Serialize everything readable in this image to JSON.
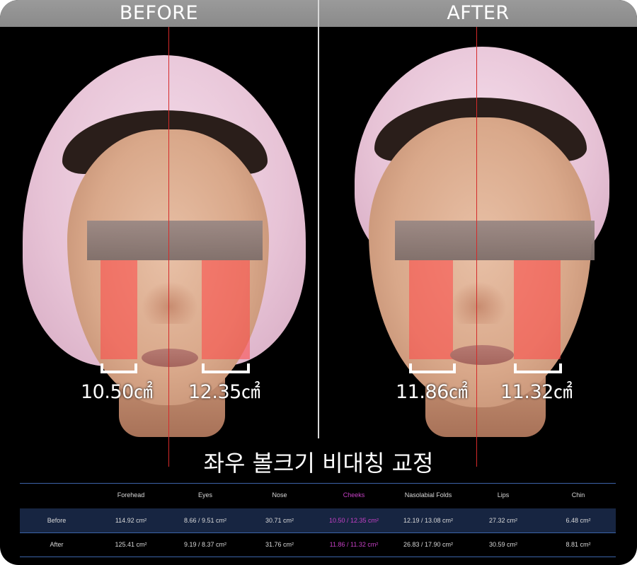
{
  "header": {
    "before_label": "BEFORE",
    "after_label": "AFTER"
  },
  "before_panel": {
    "left_cheek_area": "10.50㎠",
    "right_cheek_area": "12.35㎠"
  },
  "after_panel": {
    "left_cheek_area": "11.86㎠",
    "right_cheek_area": "11.32㎠"
  },
  "title": "좌우 볼크기 비대칭 교정",
  "table": {
    "columns": [
      "",
      "Forehead",
      "Eyes",
      "Nose",
      "Cheeks",
      "Nasolabial Folds",
      "Lips",
      "Chin"
    ],
    "highlight_column": "Cheeks",
    "rows": [
      {
        "label": "Before",
        "values": [
          "114.92 cm²",
          "8.66 / 9.51 cm²",
          "30.71 cm²",
          "10.50 / 12.35 cm²",
          "12.19 / 13.08 cm²",
          "27.32 cm²",
          "6.48 cm²"
        ]
      },
      {
        "label": "After",
        "values": [
          "125.41 cm²",
          "9.19 / 8.37 cm²",
          "31.76 cm²",
          "11.86 / 11.32 cm²",
          "26.83 / 17.90 cm²",
          "30.59 cm²",
          "8.81 cm²"
        ]
      }
    ]
  },
  "colors": {
    "background": "#000000",
    "header_bar": "#8f8f8f",
    "midline": "#d42a2a",
    "cheek_overlay": "#ff4646",
    "table_line": "#3c63a8",
    "highlight_row": "#172541",
    "highlight_text": "#c640c6"
  }
}
